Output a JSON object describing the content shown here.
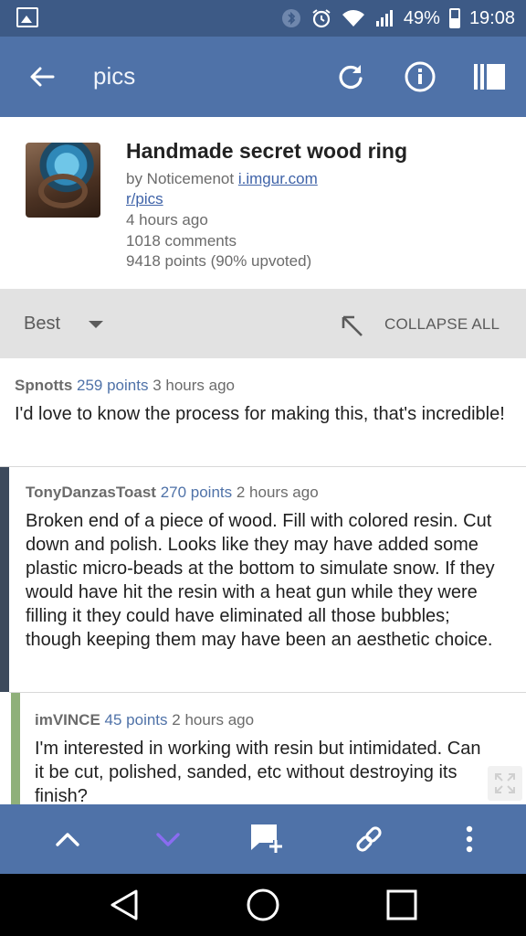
{
  "status_bar": {
    "battery": "49%",
    "time": "19:08",
    "icons": [
      "gallery-icon",
      "bluetooth-icon",
      "alarm-icon",
      "wifi-icon",
      "signal-icon",
      "battery-icon"
    ]
  },
  "app_bar": {
    "title": "pics",
    "icons": [
      "back-arrow-icon",
      "refresh-icon",
      "info-icon",
      "sidebar-icon"
    ]
  },
  "post": {
    "title": "Handmade secret wood ring",
    "by_prefix": "by Noticemenot",
    "domain": "i.imgur.com",
    "subreddit": "r/pics",
    "age": "4 hours ago",
    "comments": "1018 comments",
    "points": "9418 points (90% upvoted)"
  },
  "sort_bar": {
    "sort_label": "Best",
    "collapse_label": "COLLAPSE ALL"
  },
  "comments": [
    {
      "author": "Spnotts",
      "points": "259 points",
      "age": "3 hours ago",
      "body": "I'd love to know the process for making this, that's incredible!"
    },
    {
      "author": "TonyDanzasToast",
      "points": "270 points",
      "age": "2 hours ago",
      "body": "Broken end of a piece of wood. Fill with colored resin. Cut down and polish. Looks like they may have added some plastic micro-beads at the bottom to simulate snow. If they would have hit the resin with a heat gun while they were filling it they could have eliminated all those bubbles; though keeping them may have been an aesthetic choice."
    },
    {
      "author": "imVINCE",
      "points": "45 points",
      "age": "2 hours ago",
      "body": "I'm interested in working with resin but intimidated. Can it be cut, polished, sanded, etc without destroying its finish?"
    }
  ],
  "colors": {
    "status_bar": "#3d5a86",
    "app_bar": "#4f72a8",
    "points_text": "#4f72a8",
    "depth1_bar": "#3d4a5c",
    "depth2_bar": "#8fb07a",
    "down_arrow_accent": "#8a6cf0"
  },
  "toolbar": {
    "icons": [
      "chevron-up-icon",
      "chevron-down-icon",
      "add-comment-icon",
      "link-icon",
      "more-vert-icon"
    ]
  },
  "nav": {
    "icons": [
      "nav-back-icon",
      "nav-home-icon",
      "nav-recents-icon"
    ]
  }
}
